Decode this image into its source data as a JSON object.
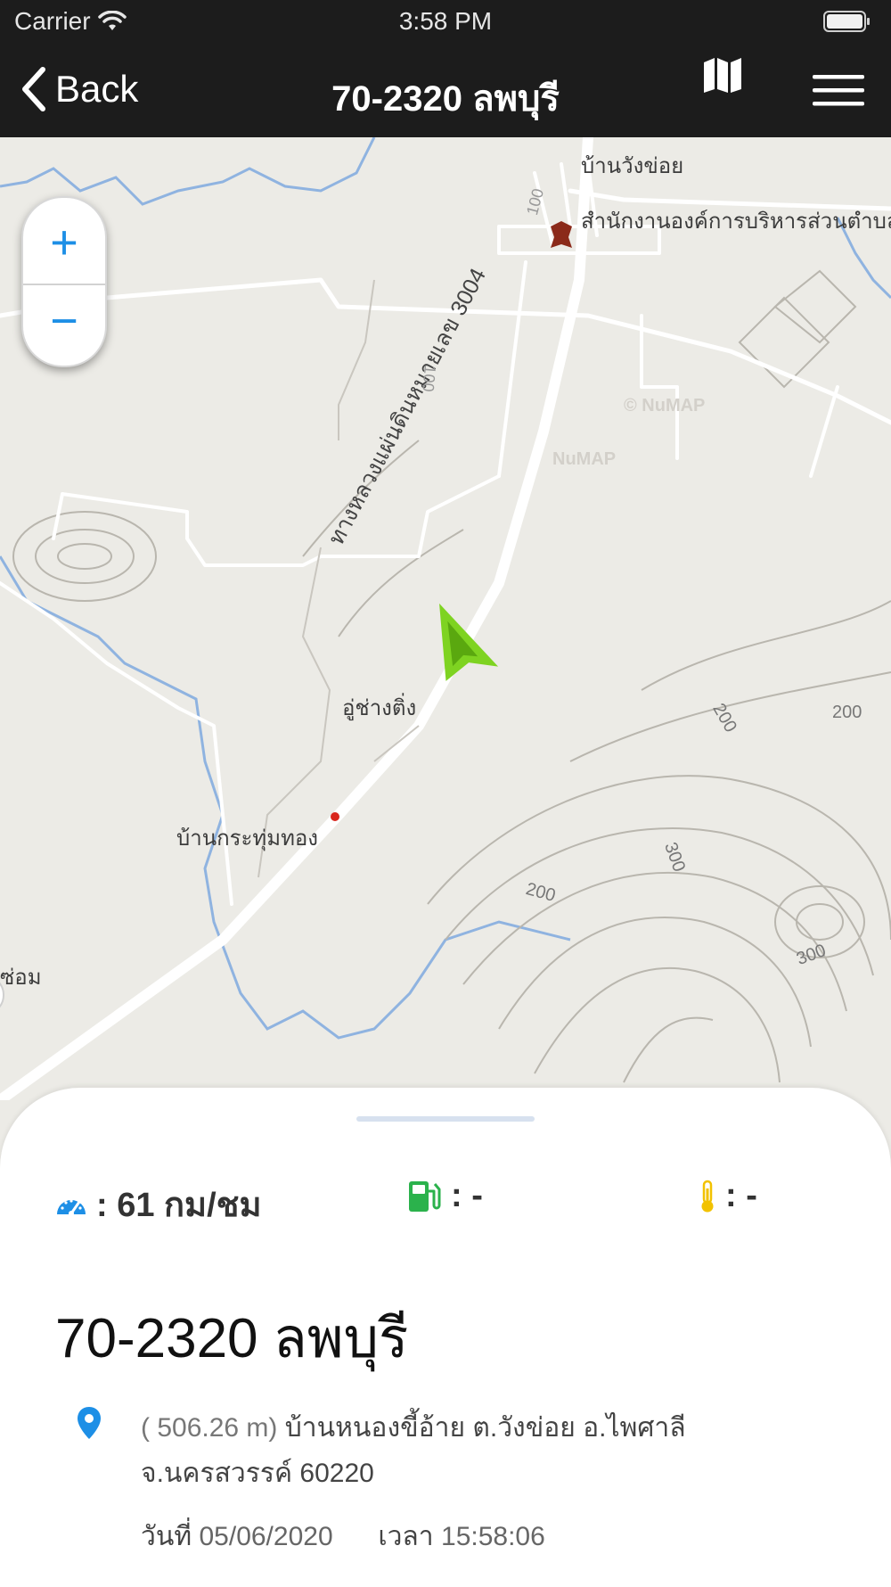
{
  "status_bar": {
    "carrier": "Carrier",
    "time": "3:58 PM"
  },
  "nav": {
    "back_label": "Back",
    "title": "70-2320 ลพบุรี",
    "map_icon": "map-icon",
    "menu_icon": "hamburger-menu-icon"
  },
  "map": {
    "zoom_in_label": "+",
    "zoom_out_label": "−",
    "labels": {
      "village_wang_khoi": "บ้านวังข่อย",
      "sao_office": "สำนักงานองค์การบริหารส่วนตำบล",
      "highway": "ทางหลวงแผ่นดินหมายเลข 3004",
      "garage": "อู่ช่างติ่ง",
      "village_krathum_thong": "บ้านกระทุ่มทอง",
      "cut_label": "ซ่อม",
      "watermark_1": "© NuMAP",
      "watermark_2": "NuMAP"
    },
    "contours": {
      "c1": "200",
      "c2": "200",
      "c3": "300",
      "c4": "200",
      "c5": "300",
      "road_km_1": "100",
      "road_km_2": "100"
    }
  },
  "sheet": {
    "speed": ": 61 กม/ชม",
    "fuel": ": -",
    "temperature": ": -",
    "vehicle_name": "70-2320 ลพบุรี",
    "distance": "( 506.26 m)",
    "address": "บ้านหนองขี้อ้าย ต.วังข่อย อ.ไพศาลี จ.นครสวรรค์ 60220",
    "date_label": "วันที่",
    "date": "05/06/2020",
    "time_label": "เวลา",
    "time": "15:58:06"
  },
  "colors": {
    "accent_blue": "#1d8fe6",
    "fuel_green": "#2bb24c",
    "temp_yellow": "#f2c200",
    "vehicle_arrow": "#7ed321"
  }
}
